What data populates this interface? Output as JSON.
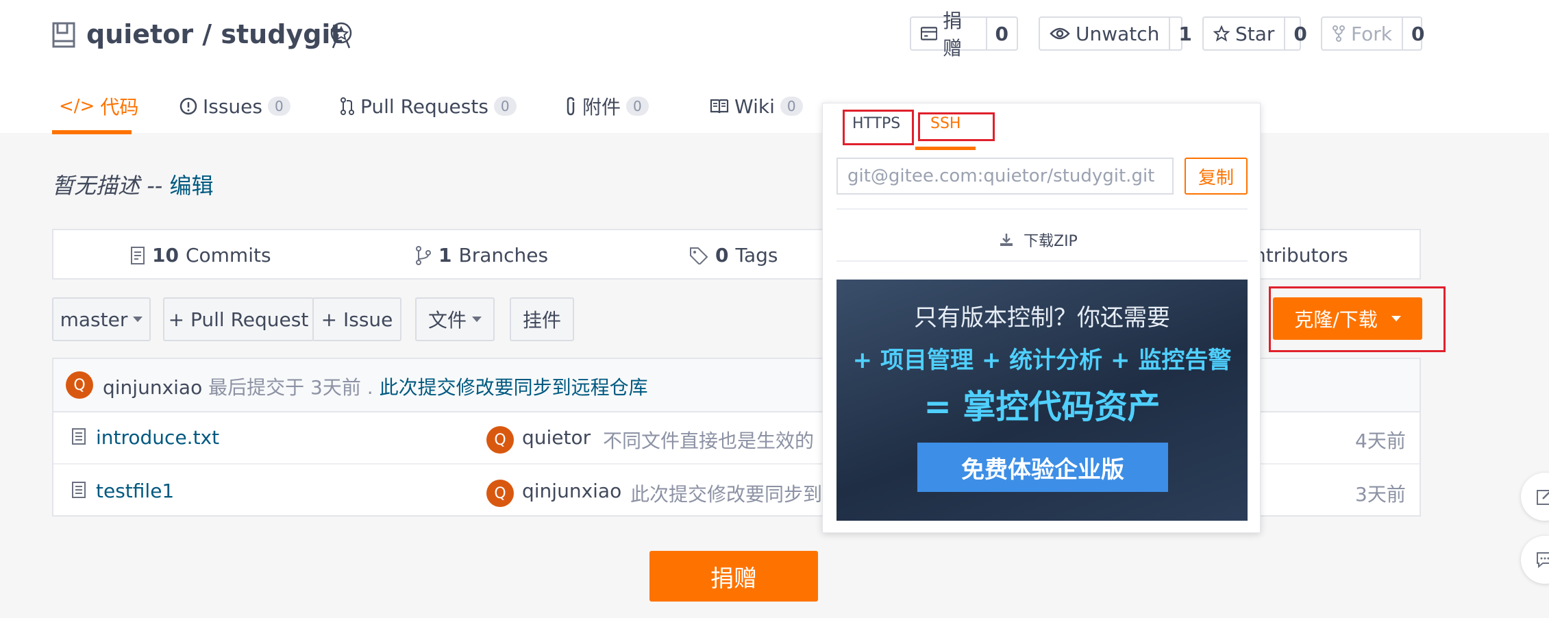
{
  "repo": {
    "title": "quietor / studygit"
  },
  "header_buttons": {
    "donate": {
      "label": "捐赠",
      "count": "0"
    },
    "watch": {
      "label": "Unwatch",
      "count": "1"
    },
    "star": {
      "label": "Star",
      "count": "0"
    },
    "fork": {
      "label": "Fork",
      "count": "0"
    }
  },
  "tabs": [
    {
      "label": "代码",
      "count": ""
    },
    {
      "label": "Issues",
      "count": "0"
    },
    {
      "label": "Pull Requests",
      "count": "0"
    },
    {
      "label": "附件",
      "count": "0"
    },
    {
      "label": "Wiki",
      "count": "0"
    }
  ],
  "description": {
    "text": "暂无描述",
    "separator": "--",
    "edit_label": "编辑"
  },
  "stats": {
    "commits": {
      "count": "10",
      "label": "Commits"
    },
    "branches": {
      "count": "1",
      "label": "Branches"
    },
    "tags": {
      "count": "0",
      "label": "Tags"
    },
    "contributors": {
      "label": "ntributors"
    }
  },
  "toolbar": {
    "branch": "master",
    "pull_request": "+ Pull Request",
    "issue": "+ Issue",
    "file": "文件",
    "plugin": "挂件",
    "clone": "克隆/下载"
  },
  "last_commit": {
    "avatar": "Q",
    "author": "qinjunxiao",
    "prefix": "最后提交于",
    "time": "3天前",
    "separator": ".",
    "message": "此次提交修改要同步到远程仓库"
  },
  "files": [
    {
      "name": "introduce.txt",
      "avatar": "Q",
      "author": "quietor",
      "message": "不同文件直接也是生效的",
      "time": "4天前"
    },
    {
      "name": "testfile1",
      "avatar": "Q",
      "author": "qinjunxiao",
      "message": "此次提交修改要同步到",
      "time": "3天前"
    }
  ],
  "donate_button": "捐赠",
  "clone_popup": {
    "tabs": [
      "HTTPS",
      "SSH"
    ],
    "active_tab": "SSH",
    "url": "git@gitee.com:quietor/studygit.git",
    "copy_label": "复制",
    "download_label": "下载ZIP"
  },
  "ad": {
    "line1": "只有版本控制？你还需要",
    "line2": "+ 项目管理 + 统计分析 + 监控告警",
    "line3": "= 掌控代码资产",
    "button": "免费体验企业版"
  },
  "colors": {
    "accent": "#fe7300",
    "link": "#005980",
    "highlight": "#e0202c"
  }
}
